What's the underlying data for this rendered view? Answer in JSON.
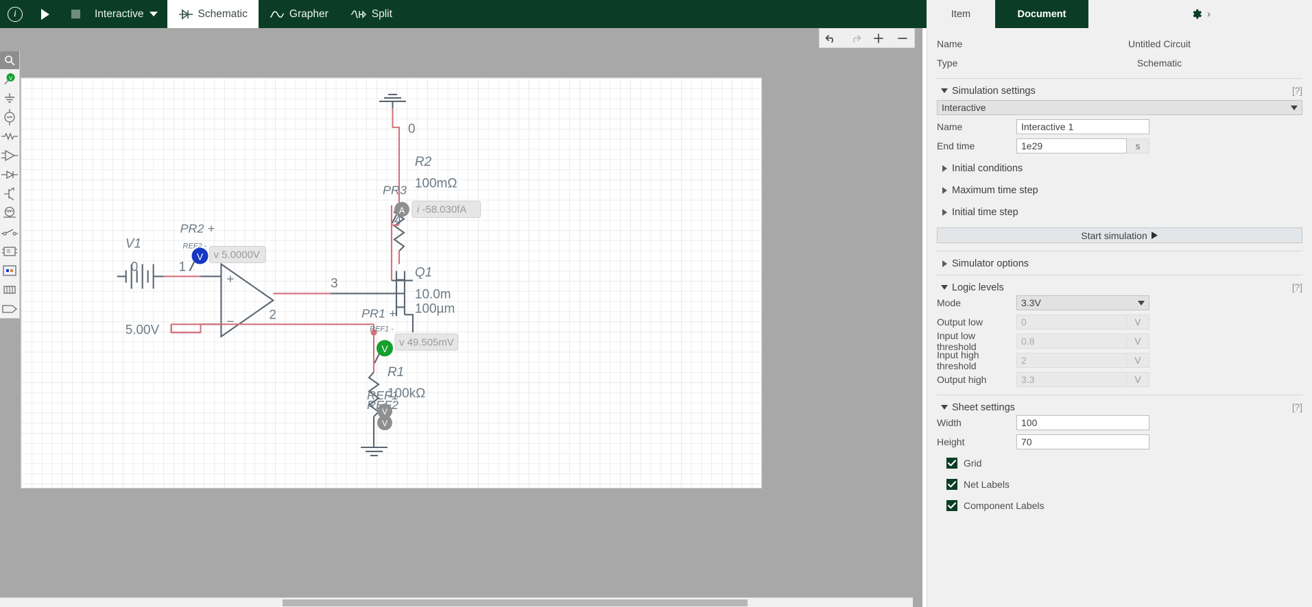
{
  "topbar": {
    "info_icon": "info-circle-icon",
    "run_icon": "play-icon",
    "stop_icon": "stop-icon",
    "mode_label": "Interactive",
    "tabs": [
      {
        "label": "Schematic",
        "icon": "diode-icon",
        "active": true
      },
      {
        "label": "Grapher",
        "icon": "waveform-icon",
        "active": false
      },
      {
        "label": "Split",
        "icon": "split-icon",
        "active": false
      }
    ]
  },
  "right_tabs": {
    "item": "Item",
    "document": "Document",
    "gear_icon": "gear-icon",
    "chevron": "›"
  },
  "left_toolbar": {
    "items": [
      {
        "name": "search-tool",
        "icon": "search-icon"
      },
      {
        "name": "voltage-probe-tool",
        "icon": "probe-icon"
      },
      {
        "name": "ground-tool",
        "icon": "ground-icon"
      },
      {
        "name": "source-tool",
        "icon": "ac-source-icon"
      },
      {
        "name": "resistor-tool",
        "icon": "resistor-icon"
      },
      {
        "name": "opamp-tool",
        "icon": "opamp-icon"
      },
      {
        "name": "diode-tool",
        "icon": "diode-icon"
      },
      {
        "name": "transistor-tool",
        "icon": "transistor-icon"
      },
      {
        "name": "motor-tool",
        "icon": "motor-icon"
      },
      {
        "name": "switch-tool",
        "icon": "switch-icon"
      },
      {
        "name": "ic-tool",
        "icon": "ic-icon"
      },
      {
        "name": "subcircuit-tool",
        "icon": "subcircuit-icon"
      },
      {
        "name": "connector-tool",
        "icon": "connector-icon"
      },
      {
        "name": "label-tool",
        "icon": "label-icon"
      }
    ]
  },
  "canvas_tools": {
    "undo": "undo-icon",
    "redo": "redo-icon",
    "zoom_in": "+",
    "zoom_out": "−"
  },
  "document": {
    "name_label": "Name",
    "name_value": "Untitled Circuit",
    "type_label": "Type",
    "type_value": "Schematic",
    "simulation": {
      "section_title": "Simulation settings",
      "help": "[?]",
      "analysis_type": "Interactive",
      "name_label": "Name",
      "name_value": "Interactive 1",
      "end_time_label": "End time",
      "end_time_value": "1e29",
      "end_time_unit": "s",
      "initial_conditions": "Initial conditions",
      "maximum_time_step": "Maximum time step",
      "initial_time_step": "Initial time step",
      "start_button": "Start simulation",
      "simulator_options": "Simulator options"
    },
    "logic_levels": {
      "section_title": "Logic levels",
      "help": "[?]",
      "mode_label": "Mode",
      "mode_value": "3.3V",
      "rows": [
        {
          "label": "Output low",
          "value": "0",
          "unit": "V"
        },
        {
          "label": "Input low threshold",
          "value": "0.8",
          "unit": "V"
        },
        {
          "label": "Input high threshold",
          "value": "2",
          "unit": "V"
        },
        {
          "label": "Output high",
          "value": "3.3",
          "unit": "V"
        }
      ]
    },
    "sheet_settings": {
      "section_title": "Sheet settings",
      "help": "[?]",
      "width_label": "Width",
      "width_value": "100",
      "height_label": "Height",
      "height_value": "70",
      "checkboxes": [
        {
          "label": "Grid",
          "checked": true
        },
        {
          "label": "Net Labels",
          "checked": true
        },
        {
          "label": "Component Labels",
          "checked": true
        }
      ]
    }
  },
  "schematic": {
    "components": [
      {
        "id": "V1",
        "designator": "V1",
        "value": "5.00V",
        "type": "voltage-source"
      },
      {
        "id": "R2",
        "designator": "R2",
        "value": "100mΩ",
        "type": "resistor"
      },
      {
        "id": "R1",
        "designator": "R1",
        "value": "100kΩ",
        "type": "resistor"
      },
      {
        "id": "Q1",
        "designator": "Q1",
        "value_w": "10.0m",
        "value_l": "100µm",
        "type": "mosfet"
      }
    ],
    "nets": [
      "0",
      "1",
      "2",
      "3",
      "4"
    ],
    "probes": [
      {
        "id": "PR2",
        "plus_label": "PR2 +",
        "ref_label": "REF2 -",
        "badge": "V",
        "reading": "v 5.0000V",
        "color": "#1637c4"
      },
      {
        "id": "PR3",
        "plus_label": "PR3",
        "badge": "A",
        "reading": "i -58.030fA",
        "color": "#8f8f8f"
      },
      {
        "id": "PR1",
        "plus_label": "PR1 +",
        "ref_label": "REF1 -",
        "badge": "V",
        "reading": "v 49.505mV",
        "color": "#14a02e"
      },
      {
        "id": "REF1",
        "plus_label": "REF1",
        "badge": "V",
        "color": "#8f8f8f"
      },
      {
        "id": "REF2",
        "plus_label": "REF2",
        "badge": "V",
        "color": "#8f8f8f"
      }
    ],
    "colors": {
      "wire": "#d4707c",
      "symbol": "#5a6570",
      "net_label": "#6d7b86",
      "accent": "#0b3d26"
    }
  }
}
